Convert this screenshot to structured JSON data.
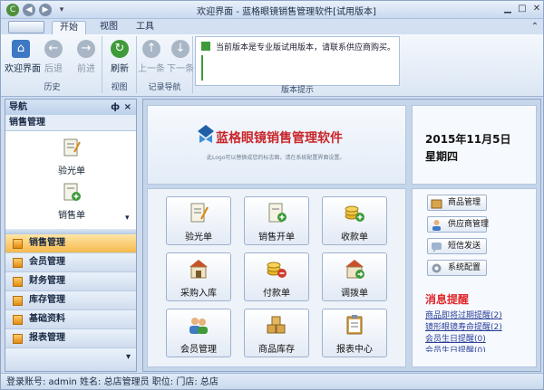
{
  "window": {
    "title": "欢迎界面 - 蓝格眼镜销售管理软件[试用版本]"
  },
  "ribbon": {
    "tabs": [
      "开始",
      "视图",
      "工具"
    ],
    "groups": {
      "history": {
        "caption": "历史",
        "buttons": [
          "欢迎界面",
          "后退",
          "前进"
        ]
      },
      "view": {
        "caption": "视图",
        "buttons": [
          "刷新"
        ]
      },
      "record_nav": {
        "caption": "记录导航",
        "buttons": [
          "上一条",
          "下一条"
        ]
      },
      "version": {
        "caption": "版本提示"
      }
    },
    "notice": "当前版本是专业版试用版本，请联系供应商购买。"
  },
  "nav": {
    "title": "导航",
    "pin": "ф",
    "close": "×",
    "section": "销售管理",
    "icons": [
      "验光单",
      "销售单"
    ],
    "scroll_hint": "▾",
    "items": [
      "销售管理",
      "会员管理",
      "财务管理",
      "库存管理",
      "基础资料",
      "报表管理"
    ],
    "active_item": "销售管理",
    "footer": "▾"
  },
  "banner": {
    "title": "蓝格眼镜销售管理软件",
    "hint": "此Logo可以替换成您的标志图，请在系统配置界面设置。"
  },
  "date": {
    "date": "2015年11月5日",
    "weekday": "星期四"
  },
  "functions": [
    "验光单",
    "销售开单",
    "收款单",
    "采购入库",
    "付款单",
    "调拨单",
    "会员管理",
    "商品库存",
    "报表中心"
  ],
  "side_buttons": [
    "商品管理",
    "供应商管理",
    "短信发送",
    "系统配置"
  ],
  "messages": {
    "title": "消息提醒",
    "items": [
      "商品即将过期提醒(2)",
      "镜形眼镜寿命提醒(2)",
      "会员生日提醒(0)",
      "会员生日提醒(0)"
    ]
  },
  "status": "登录账号: admin  姓名: 总店管理员  职位:  门店: 总店",
  "colors": {
    "accent": "#1f5fa8",
    "brand_red": "#c8262a",
    "alert_red": "#e0282c",
    "nav_active": "#f5b94d"
  }
}
